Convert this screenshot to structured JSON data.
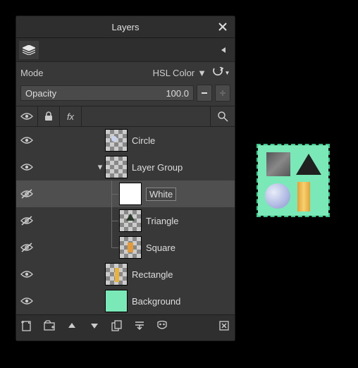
{
  "panel": {
    "title": "Layers"
  },
  "mode": {
    "label": "Mode",
    "value": "HSL Color"
  },
  "opacity": {
    "label": "Opacity",
    "value": "100.0"
  },
  "columns": {
    "fx_label": "fx"
  },
  "layers": [
    {
      "name": "Circle",
      "visible": true,
      "depth": 0,
      "thumb": "circle",
      "expander": "",
      "selected": false,
      "editing": false
    },
    {
      "name": "Layer Group",
      "visible": true,
      "depth": 0,
      "thumb": "group",
      "expander": "down",
      "selected": false,
      "editing": false
    },
    {
      "name": "White",
      "visible": false,
      "depth": 1,
      "thumb": "white",
      "expander": "",
      "selected": true,
      "editing": true
    },
    {
      "name": "Triangle",
      "visible": false,
      "depth": 1,
      "thumb": "triangle",
      "expander": "",
      "selected": false,
      "editing": false
    },
    {
      "name": "Square",
      "visible": false,
      "depth": 1,
      "thumb": "square",
      "expander": "",
      "selected": false,
      "editing": false,
      "last": true
    },
    {
      "name": "Rectangle",
      "visible": true,
      "depth": 0,
      "thumb": "rect",
      "expander": "",
      "selected": false,
      "editing": false
    },
    {
      "name": "Background",
      "visible": true,
      "depth": 0,
      "thumb": "bg",
      "expander": "",
      "selected": false,
      "editing": false
    }
  ],
  "icons": {
    "layers_tab": "layers-icon",
    "tab_menu": "menu-left-icon",
    "swap": "swap-icon",
    "eye": "eye-icon",
    "lock": "lock-icon",
    "search": "search-icon",
    "new_layer": "new-layer-icon",
    "new_group": "new-group-icon",
    "raise": "raise-icon",
    "lower": "lower-icon",
    "duplicate": "duplicate-icon",
    "merge": "merge-icon",
    "mask": "mask-icon",
    "delete": "delete-icon"
  }
}
